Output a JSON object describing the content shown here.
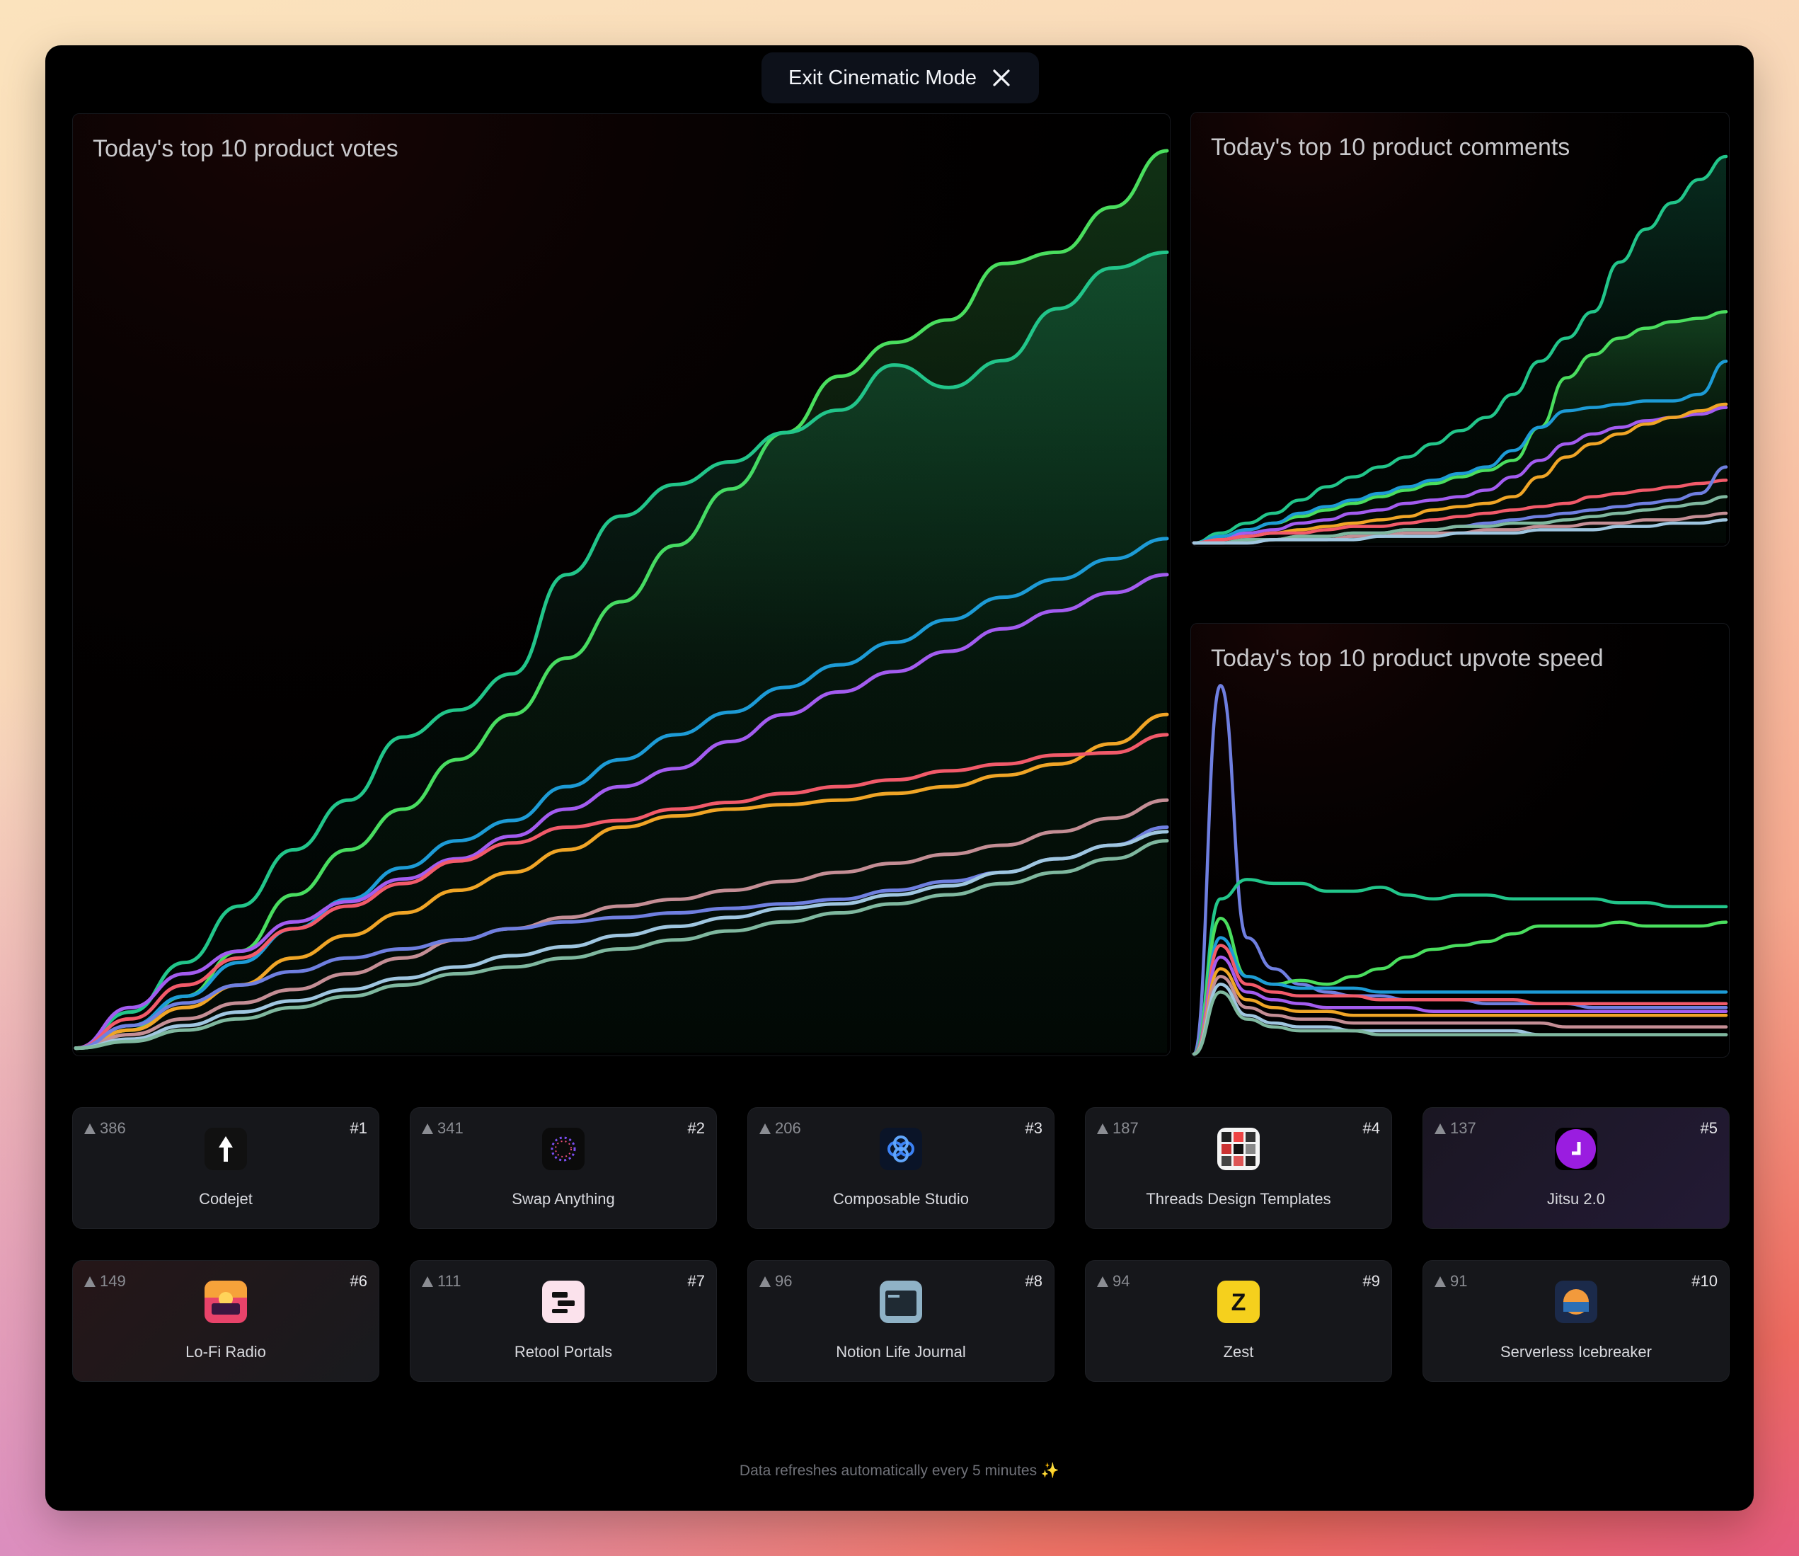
{
  "window": {
    "exit_button_label": "Exit Cinematic Mode"
  },
  "panels": {
    "votes": {
      "title": "Today's top 10 product votes"
    },
    "comments": {
      "title": "Today's top 10 product comments"
    },
    "speed": {
      "title": "Today's top 10 product upvote speed"
    }
  },
  "chart_data": [
    {
      "type": "area",
      "title": "Today's top 10 product votes",
      "xlabel": "",
      "ylabel": "",
      "x": [
        0,
        1,
        2,
        3,
        4,
        5,
        6,
        7,
        8,
        9,
        10,
        11,
        12,
        13,
        14,
        15,
        16,
        17,
        18,
        19,
        20
      ],
      "ylim": [
        0,
        400
      ],
      "grid": false,
      "series": [
        {
          "values": [
            2,
            10,
            25,
            45,
            70,
            90,
            108,
            130,
            150,
            175,
            200,
            225,
            250,
            275,
            300,
            315,
            325,
            350,
            355,
            375,
            400
          ],
          "color": "#4ade5e"
        },
        {
          "values": [
            2,
            18,
            40,
            65,
            90,
            112,
            140,
            152,
            168,
            212,
            238,
            252,
            262,
            275,
            285,
            305,
            295,
            307,
            330,
            348,
            355
          ],
          "color": "#22c58a"
        },
        {
          "values": [
            2,
            12,
            25,
            40,
            55,
            68,
            82,
            94,
            103,
            118,
            130,
            141,
            151,
            162,
            172,
            182,
            192,
            202,
            210,
            219,
            228
          ],
          "color": "#1d9bd6"
        },
        {
          "values": [
            2,
            20,
            35,
            45,
            58,
            67,
            77,
            86,
            96,
            108,
            118,
            126,
            138,
            150,
            160,
            169,
            178,
            188,
            196,
            204,
            212
          ],
          "color": "#a35cf0"
        },
        {
          "values": [
            2,
            10,
            20,
            30,
            42,
            52,
            62,
            72,
            80,
            90,
            100,
            105,
            108,
            110,
            112,
            115,
            118,
            123,
            128,
            137,
            150
          ],
          "color": "#f0a526"
        },
        {
          "values": [
            2,
            15,
            30,
            42,
            55,
            65,
            75,
            85,
            93,
            100,
            103,
            108,
            111,
            115,
            118,
            121,
            125,
            128,
            132,
            133,
            141
          ],
          "color": "#f25a6a"
        },
        {
          "values": [
            2,
            8,
            15,
            22,
            28,
            35,
            42,
            50,
            55,
            60,
            65,
            68,
            72,
            76,
            80,
            84,
            88,
            92,
            98,
            104,
            112
          ],
          "color": "#c48e95"
        },
        {
          "values": [
            2,
            12,
            22,
            30,
            36,
            42,
            46,
            50,
            55,
            58,
            60,
            62,
            64,
            66,
            68,
            72,
            76,
            80,
            86,
            92,
            100
          ],
          "color": "#6f7fe0"
        },
        {
          "values": [
            2,
            6,
            12,
            18,
            23,
            28,
            33,
            38,
            43,
            47,
            52,
            56,
            60,
            64,
            66,
            70,
            74,
            80,
            86,
            92,
            98
          ],
          "color": "#9fc6e0"
        },
        {
          "values": [
            2,
            5,
            10,
            15,
            20,
            25,
            30,
            35,
            38,
            42,
            46,
            50,
            54,
            58,
            62,
            66,
            70,
            75,
            80,
            86,
            94
          ],
          "color": "#7fb89f"
        }
      ]
    },
    {
      "type": "area",
      "title": "Today's top 10 product comments",
      "xlabel": "",
      "ylabel": "",
      "x": [
        0,
        1,
        2,
        3,
        4,
        5,
        6,
        7,
        8,
        9,
        10,
        11,
        12,
        13,
        14,
        15,
        16,
        17,
        18,
        19,
        20
      ],
      "ylim": [
        0,
        120
      ],
      "grid": false,
      "series": [
        {
          "values": [
            0,
            3,
            6,
            9,
            13,
            17,
            20,
            23,
            26,
            30,
            34,
            38,
            45,
            55,
            62,
            70,
            85,
            95,
            103,
            110,
            117
          ],
          "color": "#22c58a"
        },
        {
          "values": [
            0,
            2,
            4,
            6,
            8,
            10,
            12,
            14,
            16,
            18,
            20,
            22,
            25,
            35,
            50,
            57,
            62,
            65,
            67,
            68,
            70
          ],
          "color": "#4ade5e"
        },
        {
          "values": [
            0,
            2,
            4,
            6,
            9,
            11,
            13,
            15,
            17,
            19,
            21,
            23,
            28,
            35,
            40,
            41,
            42,
            43,
            43,
            45,
            55
          ],
          "color": "#1d9bd6"
        },
        {
          "values": [
            0,
            1,
            3,
            4,
            6,
            7,
            9,
            10,
            12,
            13,
            14,
            16,
            20,
            25,
            30,
            33,
            35,
            37,
            38,
            39,
            41
          ],
          "color": "#a35cf0"
        },
        {
          "values": [
            0,
            1,
            2,
            3,
            4,
            5,
            6,
            7,
            8,
            10,
            11,
            12,
            14,
            20,
            26,
            30,
            33,
            36,
            38,
            40,
            42
          ],
          "color": "#f0a526"
        },
        {
          "values": [
            0,
            1,
            2,
            3,
            3,
            4,
            5,
            5,
            6,
            7,
            8,
            9,
            10,
            11,
            12,
            14,
            15,
            16,
            17,
            18,
            19
          ],
          "color": "#f25a6a"
        },
        {
          "values": [
            0,
            0,
            1,
            1,
            2,
            2,
            3,
            3,
            4,
            4,
            5,
            6,
            7,
            8,
            9,
            10,
            11,
            12,
            13,
            15,
            23
          ],
          "color": "#6f7fe0"
        },
        {
          "values": [
            0,
            0,
            1,
            1,
            2,
            2,
            3,
            3,
            4,
            4,
            5,
            5,
            6,
            6,
            7,
            8,
            9,
            10,
            11,
            12,
            14
          ],
          "color": "#7fb89f"
        },
        {
          "values": [
            0,
            0,
            0,
            1,
            1,
            1,
            2,
            2,
            3,
            3,
            3,
            4,
            4,
            5,
            5,
            6,
            6,
            7,
            7,
            8,
            9
          ],
          "color": "#c48e95"
        },
        {
          "values": [
            0,
            0,
            0,
            1,
            1,
            1,
            1,
            2,
            2,
            2,
            3,
            3,
            3,
            4,
            4,
            4,
            5,
            5,
            6,
            6,
            7
          ],
          "color": "#9fc6e0"
        }
      ]
    },
    {
      "type": "line",
      "title": "Today's top 10 product upvote speed",
      "xlabel": "",
      "ylabel": "",
      "x": [
        0,
        1,
        2,
        3,
        4,
        5,
        6,
        7,
        8,
        9,
        10,
        11,
        12,
        13,
        14,
        15,
        16,
        17,
        18,
        19,
        20
      ],
      "ylim": [
        0,
        100
      ],
      "grid": false,
      "series": [
        {
          "values": [
            0,
            95,
            30,
            22,
            18,
            16,
            15,
            15,
            14,
            14,
            14,
            13,
            13,
            13,
            13,
            12,
            12,
            12,
            12,
            12,
            12
          ],
          "color": "#6f7fe0"
        },
        {
          "values": [
            0,
            40,
            45,
            44,
            44,
            42,
            42,
            43,
            41,
            40,
            41,
            41,
            40,
            40,
            40,
            40,
            39,
            39,
            38,
            38,
            38
          ],
          "color": "#22c58a"
        },
        {
          "values": [
            0,
            35,
            20,
            18,
            19,
            18,
            20,
            22,
            25,
            27,
            28,
            29,
            31,
            33,
            33,
            33,
            34,
            33,
            33,
            33,
            34
          ],
          "color": "#4ade5e"
        },
        {
          "values": [
            0,
            30,
            20,
            18,
            17,
            17,
            17,
            16,
            16,
            16,
            16,
            16,
            16,
            16,
            16,
            16,
            16,
            16,
            16,
            16,
            16
          ],
          "color": "#1d9bd6"
        },
        {
          "values": [
            0,
            28,
            18,
            16,
            15,
            15,
            15,
            14,
            14,
            14,
            14,
            14,
            14,
            13,
            13,
            13,
            13,
            13,
            13,
            13,
            13
          ],
          "color": "#f25a6a"
        },
        {
          "values": [
            0,
            25,
            16,
            14,
            13,
            12,
            12,
            12,
            12,
            11,
            11,
            11,
            11,
            11,
            11,
            11,
            11,
            11,
            11,
            11,
            11
          ],
          "color": "#a35cf0"
        },
        {
          "values": [
            0,
            22,
            14,
            12,
            11,
            11,
            10,
            10,
            10,
            10,
            10,
            10,
            10,
            10,
            10,
            10,
            10,
            10,
            10,
            10,
            10
          ],
          "color": "#f0a526"
        },
        {
          "values": [
            0,
            20,
            12,
            10,
            9,
            9,
            8,
            8,
            8,
            8,
            8,
            8,
            8,
            8,
            7,
            7,
            7,
            7,
            7,
            7,
            7
          ],
          "color": "#c48e95"
        },
        {
          "values": [
            0,
            18,
            10,
            8,
            7,
            7,
            6,
            6,
            6,
            6,
            6,
            6,
            6,
            5,
            5,
            5,
            5,
            5,
            5,
            5,
            5
          ],
          "color": "#9fc6e0"
        },
        {
          "values": [
            0,
            16,
            9,
            7,
            6,
            6,
            6,
            5,
            5,
            5,
            5,
            5,
            5,
            5,
            5,
            5,
            5,
            5,
            5,
            5,
            5
          ],
          "color": "#7fb89f"
        }
      ]
    }
  ],
  "products": [
    {
      "rank": "#1",
      "votes": "386",
      "name": "Codejet",
      "logo": "codejet-logo",
      "color": "#111111"
    },
    {
      "rank": "#2",
      "votes": "341",
      "name": "Swap Anything",
      "logo": "swap-anything-logo",
      "color": "#0b0b0b"
    },
    {
      "rank": "#3",
      "votes": "206",
      "name": "Composable Studio",
      "logo": "composable-studio-logo",
      "color": "#1d3b6e"
    },
    {
      "rank": "#4",
      "votes": "187",
      "name": "Threads Design Templates",
      "logo": "threads-design-templates-logo",
      "color": "#f4f4f4"
    },
    {
      "rank": "#5",
      "votes": "137",
      "name": "Jitsu 2.0",
      "logo": "jitsu-logo",
      "color": "#9a1de0"
    },
    {
      "rank": "#6",
      "votes": "149",
      "name": "Lo-Fi Radio",
      "logo": "lofi-radio-logo",
      "color": "#e8436a"
    },
    {
      "rank": "#7",
      "votes": "111",
      "name": "Retool Portals",
      "logo": "retool-portals-logo",
      "color": "#f7c8d8"
    },
    {
      "rank": "#8",
      "votes": "96",
      "name": "Notion Life Journal",
      "logo": "notion-life-journal-logo",
      "color": "#8fb2c6"
    },
    {
      "rank": "#9",
      "votes": "94",
      "name": "Zest",
      "logo": "zest-logo",
      "color": "#f5d01d"
    },
    {
      "rank": "#10",
      "votes": "91",
      "name": "Serverless Icebreaker",
      "logo": "serverless-icebreaker-logo",
      "color": "#1b2a4a"
    }
  ],
  "footer": {
    "text": "Data refreshes automatically every 5 minutes ✨"
  }
}
